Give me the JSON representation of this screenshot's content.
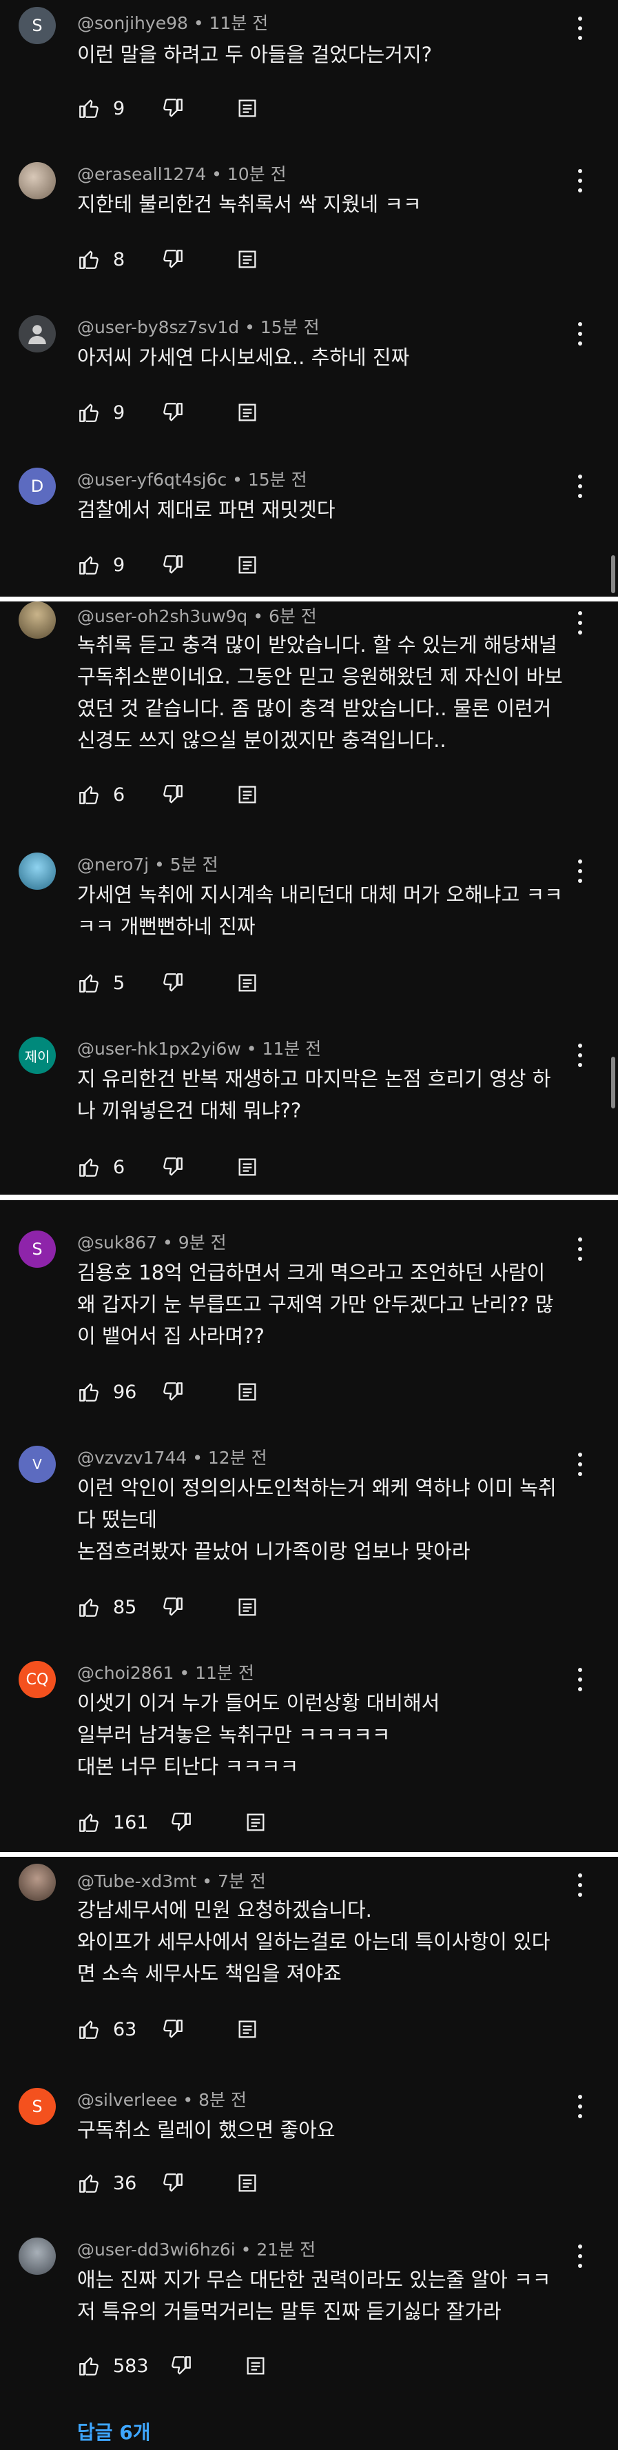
{
  "icons": {
    "like": "thumbs-up-icon",
    "dislike": "thumbs-down-icon",
    "reply": "reply-icon",
    "more": "more-vertical-icon"
  },
  "colors": {
    "background": "#0f0f0f",
    "text": "#f1f1f1",
    "meta": "#aaaaaa",
    "link": "#3ea6ff"
  },
  "comments": [
    {
      "avatar": "S",
      "author": "@sonjihye98",
      "time": "11분 전",
      "lines": [
        "이런 말을 하려고 두 아들을 걸었다는거지?"
      ],
      "likes": "9"
    },
    {
      "avatar": "",
      "author": "@eraseall1274",
      "time": "10분 전",
      "lines": [
        "지한테 불리한건 녹취록서 싹 지웠네 ㅋㅋ"
      ],
      "likes": "8"
    },
    {
      "avatar": "",
      "author": "@user-by8sz7sv1d",
      "time": "15분 전",
      "lines": [
        "아저씨 가세연 다시보세요.. 추하네 진짜"
      ],
      "likes": "9"
    },
    {
      "avatar": "D",
      "author": "@user-yf6qt4sj6c",
      "time": "15분 전",
      "lines": [
        "검찰에서 제대로 파면 재밋겟다"
      ],
      "likes": "9"
    },
    {
      "avatar": "",
      "author": "@user-oh2sh3uw9q",
      "time": "6분 전",
      "lines": [
        "녹취록 듣고 충격 많이 받았습니다. 할 수 있는게 해당채널",
        "구독취소뿐이네요. 그동안 믿고 응원해왔던 제 자신이 바보",
        "였던 것 같습니다. 좀 많이 충격 받았습니다.. 물론 이런거",
        "신경도 쓰지 않으실 분이겠지만 충격입니다.."
      ],
      "likes": "6"
    },
    {
      "avatar": "",
      "author": "@nero7j",
      "time": "5분 전",
      "lines": [
        "가세연 녹취에 지시계속 내리던대 대체 머가 오해냐고 ㅋㅋ",
        "ㅋㅋ 개뻔뻔하네 진짜"
      ],
      "likes": "5"
    },
    {
      "avatar": "제이",
      "author": "@user-hk1px2yi6w",
      "time": "11분 전",
      "lines": [
        "지 유리한건 반복 재생하고 마지막은 논점 흐리기 영상 하",
        "나 끼워넣은건 대체 뭐냐??"
      ],
      "likes": "6"
    },
    {
      "avatar": "S",
      "author": "@suk867",
      "time": "9분 전",
      "lines": [
        "김용호 18억 언급하면서 크게 멱으라고 조언하던 사람이",
        "왜 갑자기 눈 부릅뜨고 구제역 가만 안두겠다고 난리?? 많",
        "이 뱉어서 집 사라며??"
      ],
      "likes": "96"
    },
    {
      "avatar": "V",
      "author": "@vzvzv1744",
      "time": "12분 전",
      "lines": [
        "이런 악인이 정의의사도인척하는거 왜케 역하냐 이미 녹취",
        "다 떴는데",
        "논점흐려봤자 끝났어 니가족이랑  업보나 맞아라"
      ],
      "likes": "85"
    },
    {
      "avatar": "CQ",
      "author": "@choi2861",
      "time": "11분 전",
      "lines": [
        "이샛기 이거 누가 들어도 이런상황 대비해서",
        "일부러 남겨놓은 녹취구만 ㅋㅋㅋㅋㅋ",
        "대본 너무 티난다 ㅋㅋㅋㅋ"
      ],
      "likes": "161"
    },
    {
      "avatar": "",
      "author": "@Tube-xd3mt",
      "time": "7분 전",
      "lines": [
        "강남세무서에 민원 요청하겠습니다.",
        "와이프가 세무사에서 일하는걸로 아는데 특이사항이 있다",
        "면 소속 세무사도 책임을 져야죠"
      ],
      "likes": "63"
    },
    {
      "avatar": "S",
      "author": "@silverleee",
      "time": "8분 전",
      "lines": [
        "구독취소 릴레이 했으면 좋아요"
      ],
      "likes": "36"
    },
    {
      "avatar": "",
      "author": "@user-dd3wi6hz6i",
      "time": "21분 전",
      "lines": [
        "애는 진짜 지가 무슨 대단한 권력이라도 있는줄 알아 ㅋㅋ",
        "저 특유의 거들먹거리는 말투 진짜 듣기싫다 잘가라"
      ],
      "likes": "583"
    }
  ],
  "replies_link": "답글 6개"
}
